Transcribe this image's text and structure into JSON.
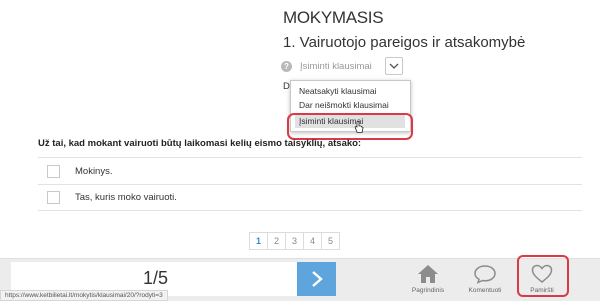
{
  "page": {
    "title": "MOKYMASIS",
    "subtitle": "1. Vairuotojo pareigos ir atsakomybė"
  },
  "filter": {
    "help_icon": "?",
    "selected": "Įsiminti klausimai",
    "partial_text": "Do",
    "options": [
      "Neatsakyti klausimai",
      "Dar neišmokti klausimai",
      "Įsiminti klausimai"
    ]
  },
  "question": {
    "text": "Už tai, kad mokant vairuoti būtų laikomasi kelių eismo taisyklių, atsako:",
    "answers": [
      "Mokinys.",
      "Tas, kuris moko vairuoti."
    ]
  },
  "pagination": {
    "pages": [
      "1",
      "2",
      "3",
      "4",
      "5"
    ],
    "active": "1"
  },
  "bottom_bar": {
    "counter": "1/5",
    "nav": [
      {
        "label": "Pagrindinis",
        "icon": "home-icon"
      },
      {
        "label": "Komentuoti",
        "icon": "comment-icon"
      },
      {
        "label": "Pamiršti",
        "icon": "heart-icon"
      }
    ]
  },
  "status_bar": {
    "url": "https://www.ketbilietai.lt/mokytis/klausimai/20/?rodyti=3"
  },
  "colors": {
    "accent_blue": "#5ea5dd",
    "highlight_red": "#d93a45",
    "bottom_bar_bg": "#ececec"
  }
}
